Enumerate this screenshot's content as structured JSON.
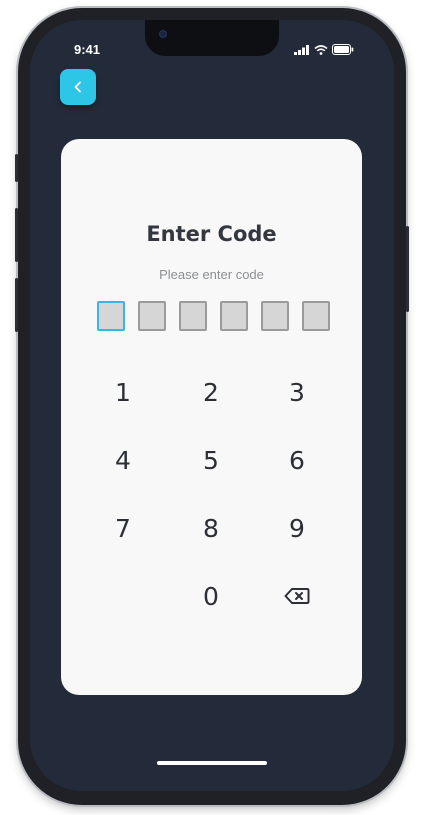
{
  "status_bar": {
    "time": "9:41",
    "icons": [
      "signal-icon",
      "wifi-icon",
      "battery-icon"
    ]
  },
  "header": {
    "back_icon": "chevron-left-icon",
    "back_color": "#2ec6e6"
  },
  "card": {
    "title": "Enter Code",
    "subtitle": "Please enter code",
    "code_length": 6,
    "active_box_color": "#38b7e6"
  },
  "keypad": {
    "keys": [
      "1",
      "2",
      "3",
      "4",
      "5",
      "6",
      "7",
      "8",
      "9",
      "0"
    ],
    "delete_icon": "backspace-icon"
  },
  "colors": {
    "background": "#232b3a",
    "card": "#f8f8f8",
    "accent": "#2ec6e6"
  }
}
